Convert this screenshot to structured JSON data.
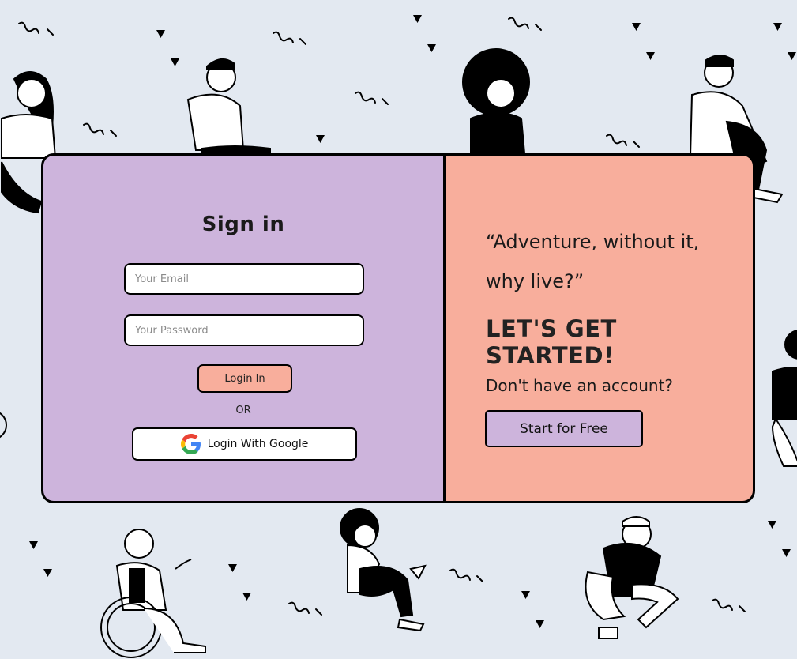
{
  "colors": {
    "background": "#e3e9f1",
    "left_panel": "#cdb4dc",
    "right_panel": "#f8ae9c",
    "border": "#000000"
  },
  "signin": {
    "title": "Sign in",
    "email_placeholder": "Your Email",
    "password_placeholder": "Your Password",
    "login_label": "Login In",
    "or_label": "OR",
    "google_label": "Login With Google",
    "google_icon": "google-g-icon"
  },
  "signup": {
    "quote": "“Adventure, without it, why live?”",
    "heading": "LET'S GET STARTED!",
    "prompt": "Don't have an account?",
    "start_label": "Start for Free"
  }
}
